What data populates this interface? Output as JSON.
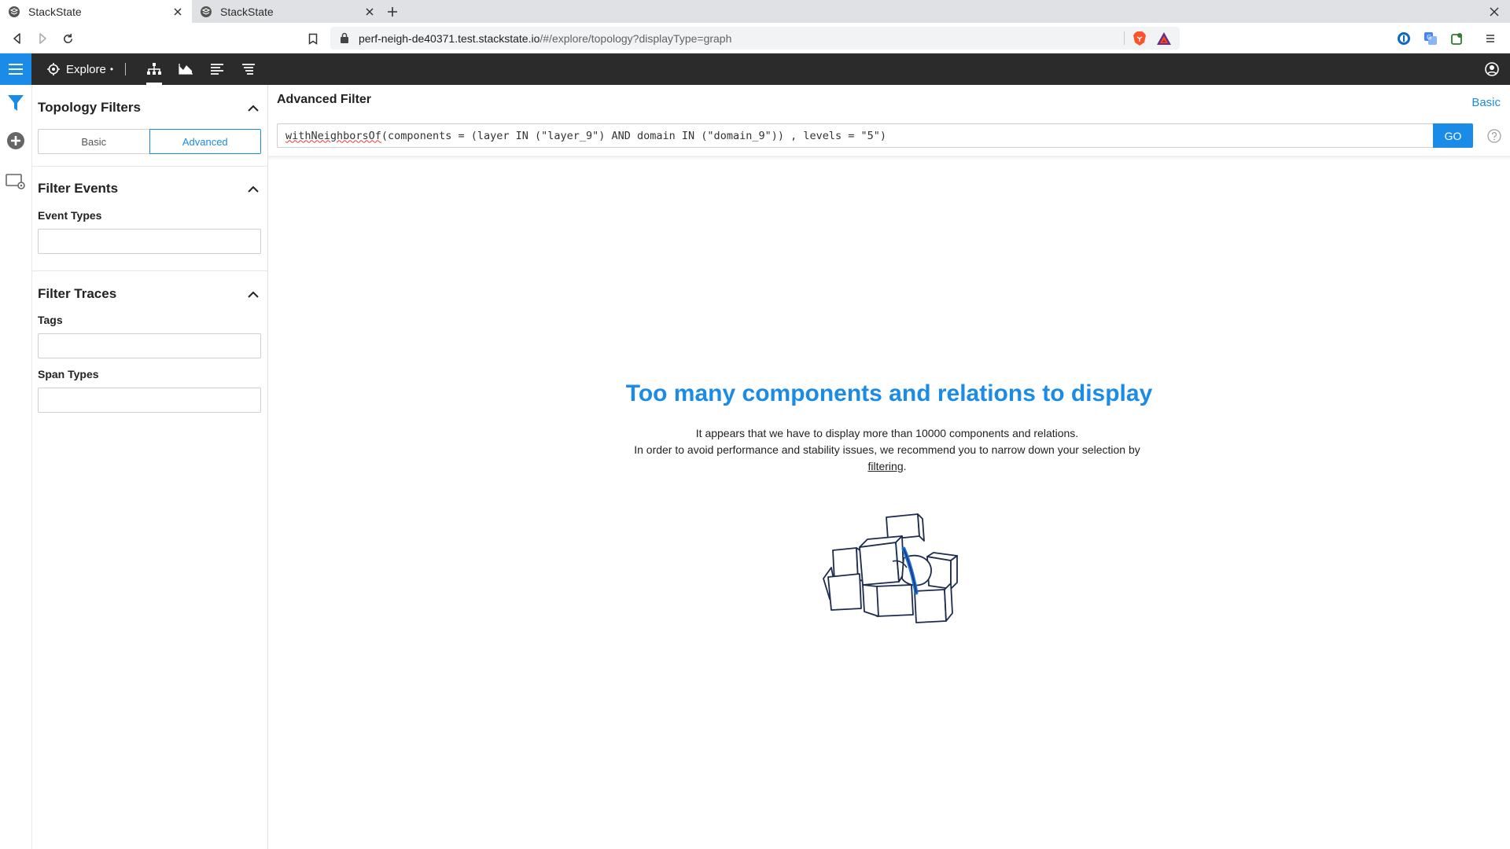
{
  "browser": {
    "tabs": [
      {
        "title": "StackState",
        "active": true
      },
      {
        "title": "StackState",
        "active": false
      }
    ],
    "url_host": "perf-neigh-de40371.test.stackstate.io",
    "url_path": "/#/explore/topology?displayType=graph"
  },
  "app": {
    "nav_label": "Explore",
    "nav_dot": "•",
    "accent_color": "#1a8be6",
    "header_color": "#2b2b2b",
    "views": [
      "topology-view-icon",
      "area-chart-icon",
      "events-list-icon",
      "traces-list-icon"
    ]
  },
  "filters": {
    "topology": {
      "title": "Topology Filters",
      "modes": [
        "Basic",
        "Advanced"
      ],
      "selected_mode": "Advanced"
    },
    "events": {
      "title": "Filter Events",
      "event_types_label": "Event Types",
      "event_types_value": ""
    },
    "traces": {
      "title": "Filter Traces",
      "tags_label": "Tags",
      "tags_value": "",
      "span_types_label": "Span Types",
      "span_types_value": ""
    }
  },
  "main": {
    "title": "Advanced Filter",
    "basic_link": "Basic",
    "query_fn": "withNeighborsOf",
    "query_rest": "(components = (layer IN (\"layer_9\") AND domain IN (\"domain_9\")) , levels = \"5\")",
    "go_label": "GO",
    "empty_title": "Too many components and relations to display",
    "empty_line1": "It appears that we have to display more than 10000 components and relations.",
    "empty_line2": "In order to avoid performance and stability issues, we recommend you to narrow down your selection by",
    "empty_link": "filtering",
    "empty_end": "."
  }
}
